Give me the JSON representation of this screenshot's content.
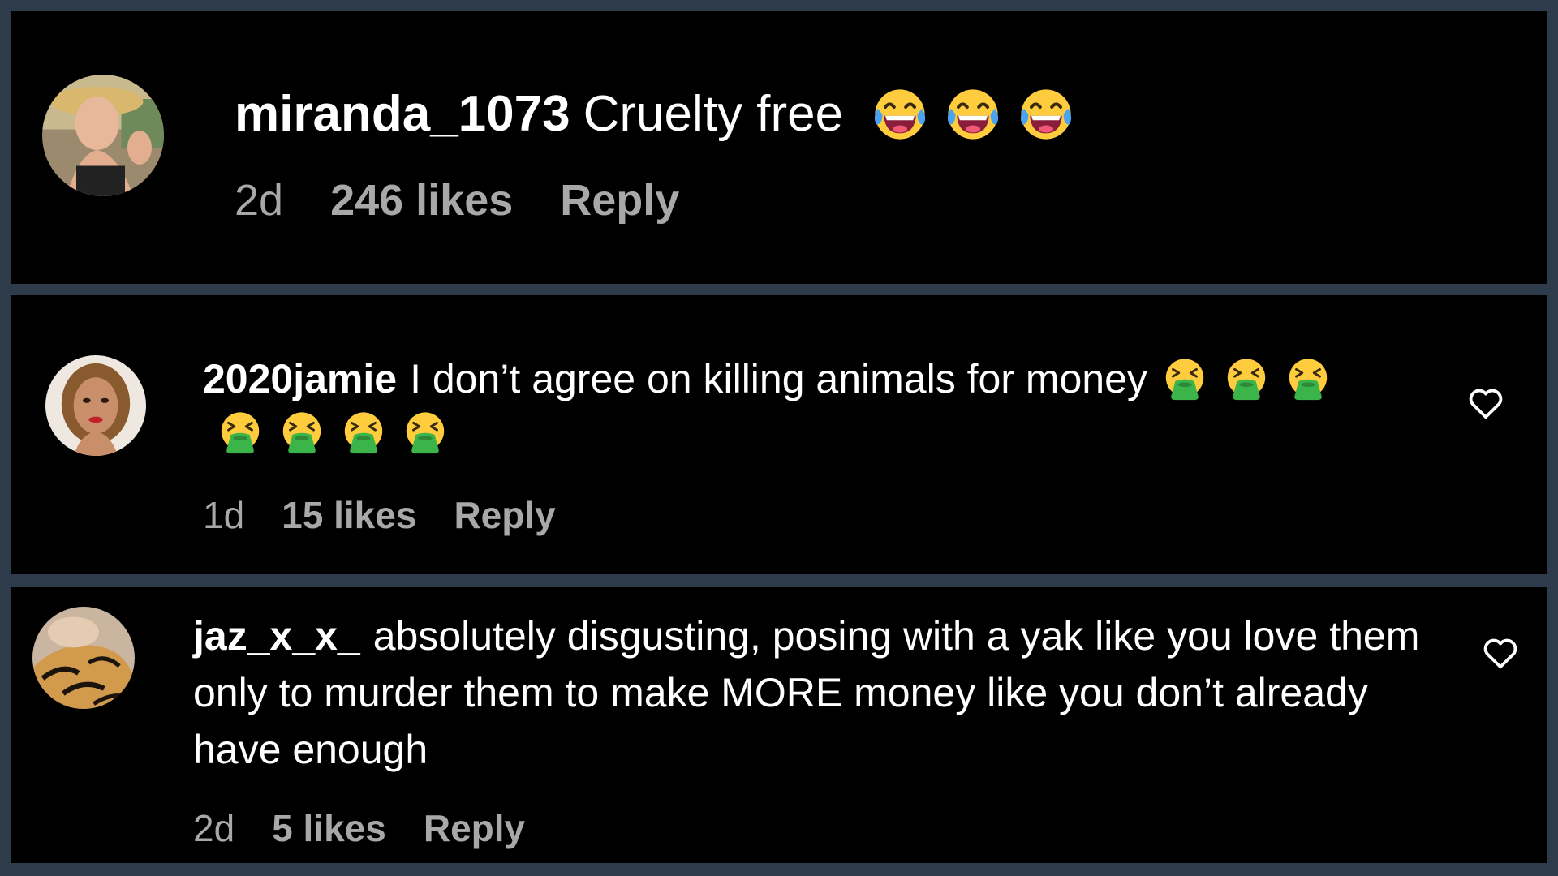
{
  "comments": [
    {
      "username": "miranda_1073",
      "text": "Cruelty free",
      "emoji": [
        "tears-of-joy",
        "tears-of-joy",
        "tears-of-joy"
      ],
      "time": "2d",
      "likes": "246 likes",
      "reply_label": "Reply",
      "has_like_button": false
    },
    {
      "username": "2020jamie",
      "text": "I don’t agree on killing animals for money",
      "emoji": [
        "nauseated",
        "nauseated",
        "nauseated",
        "nauseated",
        "nauseated",
        "nauseated",
        "nauseated"
      ],
      "time": "1d",
      "likes": "15 likes",
      "reply_label": "Reply",
      "has_like_button": true
    },
    {
      "username": "jaz_x_x_",
      "text": "absolutely disgusting, posing with a yak like you love them only to murder them to make MORE money like you don’t already have enough",
      "emoji": [],
      "time": "2d",
      "likes": "5 likes",
      "reply_label": "Reply",
      "has_like_button": true
    }
  ],
  "colors": {
    "background": "#000000",
    "frame": "#2d3b4a",
    "text": "#ffffff",
    "meta": "#a8a8a8",
    "emoji_yellow": "#ffcc3d",
    "emoji_green": "#3bb54a"
  },
  "icons": {
    "like": "heart-outline-icon",
    "laugh": "face-with-tears-of-joy-icon",
    "sick": "face-vomiting-icon"
  }
}
